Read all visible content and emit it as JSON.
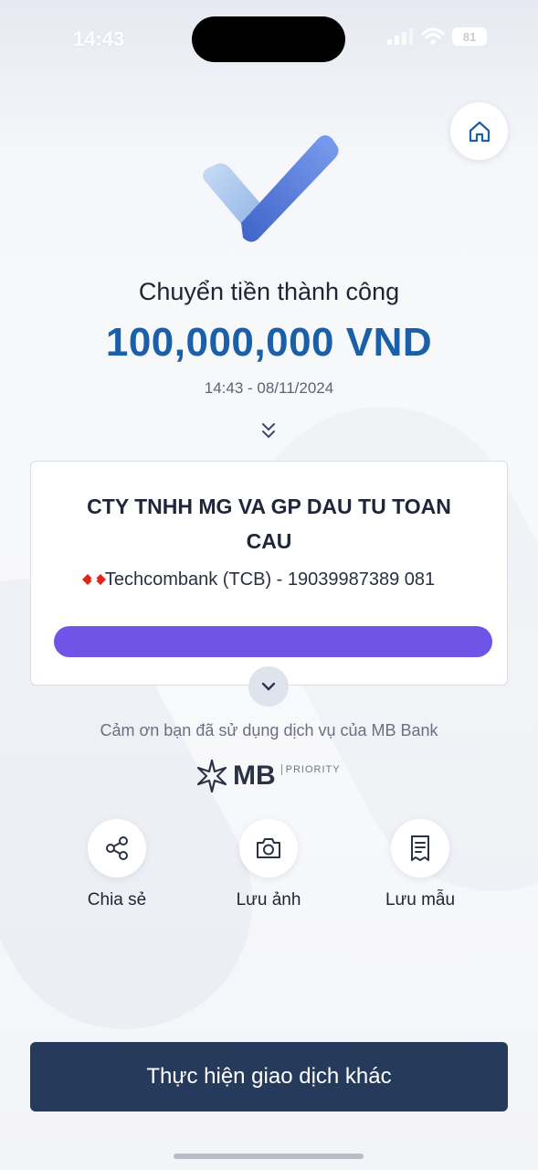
{
  "status_bar": {
    "time": "14:43",
    "battery": "81"
  },
  "result": {
    "title": "Chuyển tiền thành công",
    "amount": "100,000,000 VND",
    "datetime": "14:43 - 08/11/2024"
  },
  "recipient": {
    "name": "CTY TNHH MG VA GP DAU TU TOAN CAU",
    "bank_and_account": "Techcombank (TCB) - 19039987389 081",
    "bank_icon": "techcombank-logo"
  },
  "thanks_text": "Cảm ơn bạn đã sử dụng dịch vụ của MB Bank",
  "brand": {
    "logo_text": "MB",
    "tier": "PRIORITY"
  },
  "actions": [
    {
      "label": "Chia sẻ",
      "icon": "share-icon"
    },
    {
      "label": "Lưu ảnh",
      "icon": "camera-icon"
    },
    {
      "label": "Lưu mẫu",
      "icon": "template-icon"
    }
  ],
  "cta_label": "Thực hiện giao dịch khác",
  "colors": {
    "amount": "#1b5fa8",
    "cta_bg": "#263a5c",
    "redaction": "#6f55e7"
  }
}
